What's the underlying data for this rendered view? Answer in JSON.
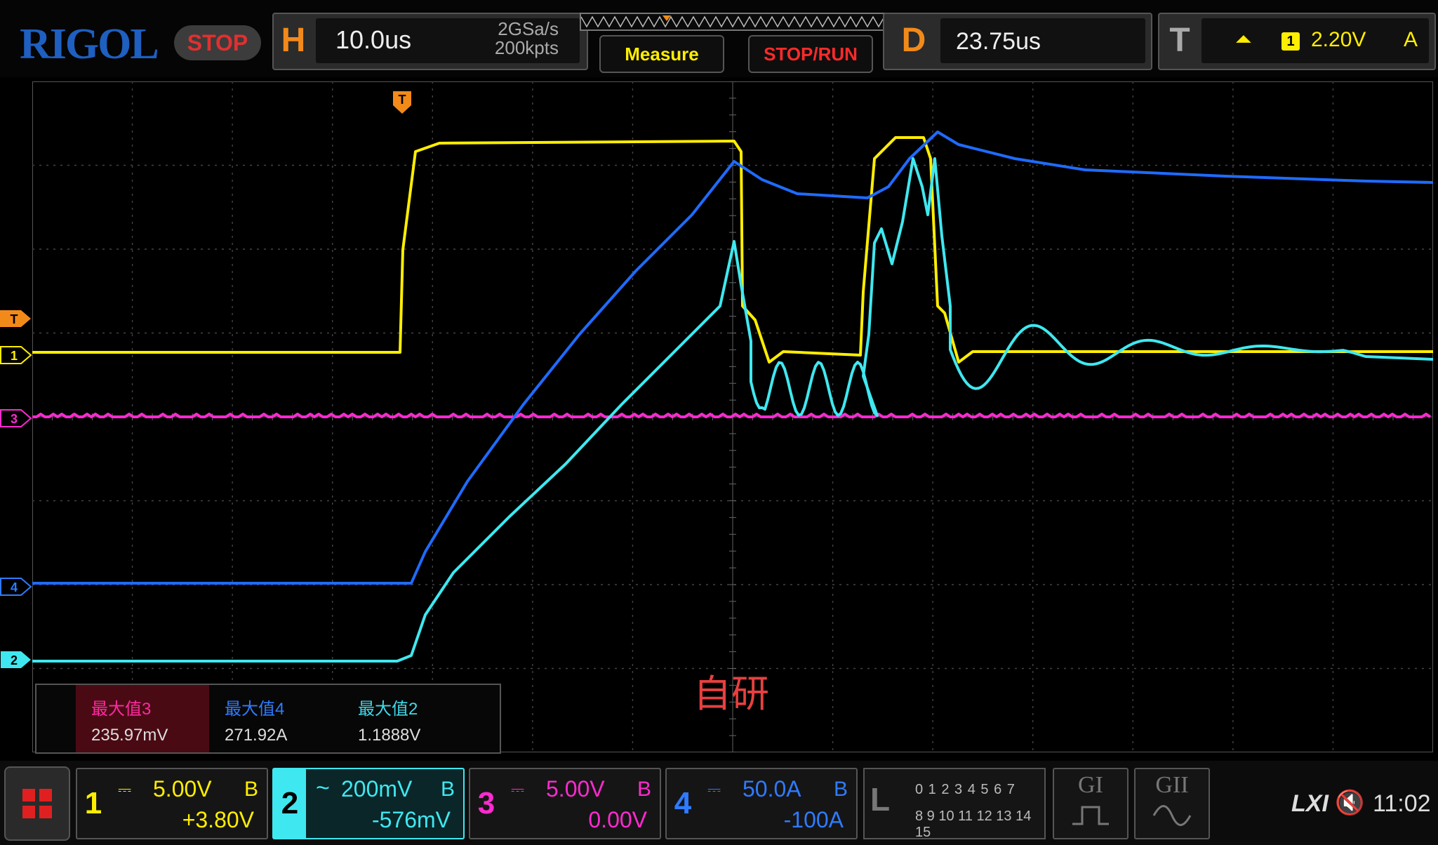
{
  "brand": "RIGOL",
  "run_state": "STOP",
  "horizontal": {
    "letter": "H",
    "timebase": "10.0us",
    "sample_rate": "2GSa/s",
    "memory_depth": "200kpts"
  },
  "buttons": {
    "measure": "Measure",
    "stop_run": "STOP/RUN"
  },
  "delay": {
    "letter": "D",
    "value": "23.75us"
  },
  "trigger": {
    "letter": "T",
    "slope_icon": "rising-edge-icon",
    "slope_glyph": "⏶",
    "source": "1",
    "level": "2.20V",
    "mode": "A"
  },
  "markers": {
    "trigger_top": "T",
    "trigger_left": "T",
    "ch1": "1",
    "ch2": "2",
    "ch3": "3",
    "ch4": "4"
  },
  "watermark": "自研",
  "measurements": [
    {
      "label": "最大值3",
      "value": "235.97mV",
      "color": "#ff2aa0"
    },
    {
      "label": "最大值4",
      "value": "271.92A",
      "color": "#2f7bff"
    },
    {
      "label": "最大值2",
      "value": "1.1888V",
      "color": "#3fd8e8"
    }
  ],
  "channels": [
    {
      "num": "1",
      "scale": "5.00V",
      "offset": "+3.80V",
      "bw": "B",
      "color": "#ffee00"
    },
    {
      "num": "2",
      "scale": "200mV",
      "offset": "-576mV",
      "bw": "B",
      "color": "#3fe8f0"
    },
    {
      "num": "3",
      "scale": "5.00V",
      "offset": "0.00V",
      "bw": "B",
      "color": "#ff2ad0"
    },
    {
      "num": "4",
      "scale": "50.0A",
      "offset": "-100A",
      "bw": "B",
      "color": "#2f7bff"
    }
  ],
  "logic": {
    "letter": "L",
    "row1": "0 1 2 3   4 5 6 7",
    "row2": "8 9 10 11 12 13 14 15"
  },
  "generators": {
    "g1": "GI",
    "g2": "GII"
  },
  "status": {
    "lxi": "LXI",
    "time": "11:02"
  },
  "colors": {
    "ch1": "#ffee00",
    "ch2": "#3fe8f0",
    "ch3": "#ff2ad0",
    "ch4": "#1f6bff",
    "accent_orange": "#f28a1a",
    "grid": "#444444"
  }
}
